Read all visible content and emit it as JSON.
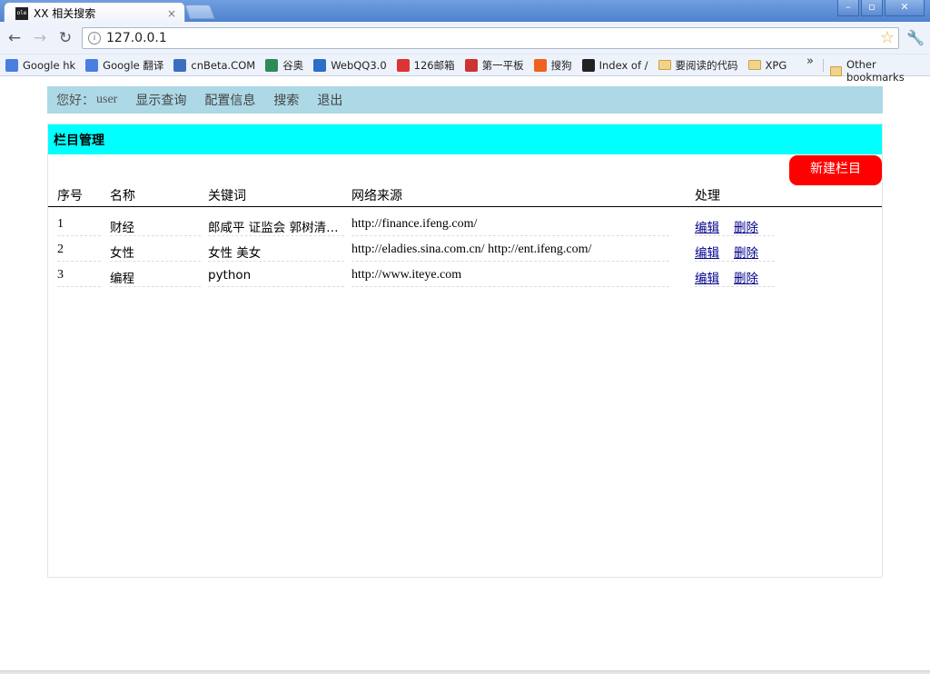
{
  "browser": {
    "tab_title": "XX 相关搜索",
    "tab_favicon_text": "ole",
    "tab_close": "×",
    "address": "127.0.0.1",
    "window_buttons": {
      "minimize": "–",
      "maximize": "▫",
      "close": "✕"
    },
    "bookmarks": [
      {
        "label": "Google hk",
        "icon": "google-icon",
        "color": "#4a7fe0"
      },
      {
        "label": "Google 翻译",
        "icon": "translate-icon",
        "color": "#4a7fe0"
      },
      {
        "label": "cnBeta.COM",
        "icon": "cnbeta-icon",
        "color": "#3a6fc0"
      },
      {
        "label": "谷奥",
        "icon": "guao-icon",
        "color": "#2e8b57"
      },
      {
        "label": "WebQQ3.0",
        "icon": "qq-icon",
        "color": "#2a6ec8"
      },
      {
        "label": "126邮箱",
        "icon": "mail126-icon",
        "color": "#d33"
      },
      {
        "label": "第一平板",
        "icon": "tablet-icon",
        "color": "#c33"
      },
      {
        "label": "搜狗",
        "icon": "sogou-icon",
        "color": "#f06020"
      },
      {
        "label": "Index of /",
        "icon": "index-icon",
        "color": "#222"
      },
      {
        "label": "要阅读的代码",
        "icon": "folder-icon",
        "color": "#f3d38a"
      },
      {
        "label": "XPG",
        "icon": "folder-icon",
        "color": "#f3d38a"
      }
    ],
    "bookmarks_more": "»",
    "other_bookmarks": "Other bookmarks"
  },
  "nav": {
    "greeting": "您好：",
    "user": "user",
    "links": [
      "显示查询",
      "配置信息",
      "搜索",
      "退出"
    ]
  },
  "panel": {
    "title": "栏目管理",
    "new_button": "新建栏目"
  },
  "table": {
    "headers": [
      "序号",
      "名称",
      "关键词",
      "网络来源",
      "处理"
    ],
    "rows": [
      {
        "no": "1",
        "name": "财经",
        "keywords": "郎咸平 证监会 郭树清…",
        "source": "http://finance.ifeng.com/",
        "edit": "编辑",
        "delete": "删除"
      },
      {
        "no": "2",
        "name": "女性",
        "keywords": "女性 美女",
        "source": "http://eladies.sina.com.cn/ http://ent.ifeng.com/",
        "edit": "编辑",
        "delete": "删除"
      },
      {
        "no": "3",
        "name": "编程",
        "keywords": "python",
        "source": "http://www.iteye.com",
        "edit": "编辑",
        "delete": "删除"
      }
    ]
  }
}
